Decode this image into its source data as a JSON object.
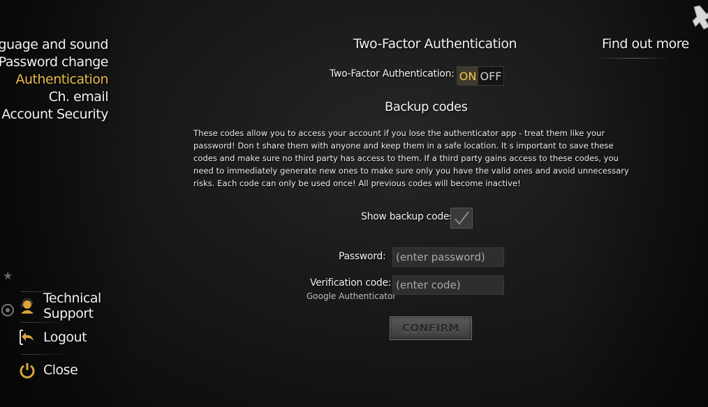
{
  "sidebar": {
    "items": [
      {
        "label": "Language and sound",
        "active": false
      },
      {
        "label": "Password change",
        "active": false
      },
      {
        "label": "Authentication",
        "active": true
      },
      {
        "label": "Ch. email",
        "active": false
      },
      {
        "label": "Account Security",
        "active": false
      }
    ],
    "bottom": {
      "support_label": "Technical Support",
      "logout_label": "Logout",
      "close_label": "Close"
    }
  },
  "header": {
    "title": "Two-Factor Authentication",
    "find_out_more": "Find out more"
  },
  "twofa": {
    "label": "Two-Factor Authentication:",
    "on": "ON",
    "off": "OFF",
    "state": "ON"
  },
  "backup": {
    "title": "Backup codes",
    "description": "These codes allow you to access your account if you lose the authenticator app - treat them like your password! Don t share them with anyone and keep them in a safe location. It s important to save these codes and make sure no third party has access to them. If a third party gains access to these codes, you need to immediately generate new ones to make sure only you have the valid ones and avoid unnecessary risks. Each code can only be used once! All previous codes will become inactive!",
    "show_label": "Show backup codes:",
    "show_checked": true
  },
  "form": {
    "password_label": "Password:",
    "password_placeholder": "(enter password)",
    "code_label": "Verification code:",
    "code_sublabel": "Google Authenticator",
    "code_placeholder": "(enter code)",
    "confirm_label": "CONFIRM"
  },
  "colors": {
    "accent": "#e9b94a",
    "text": "#f2f2f2"
  },
  "icons": {
    "close": "close-x-icon",
    "support": "headset-icon",
    "logout": "logout-arrow-icon",
    "power": "power-icon"
  }
}
